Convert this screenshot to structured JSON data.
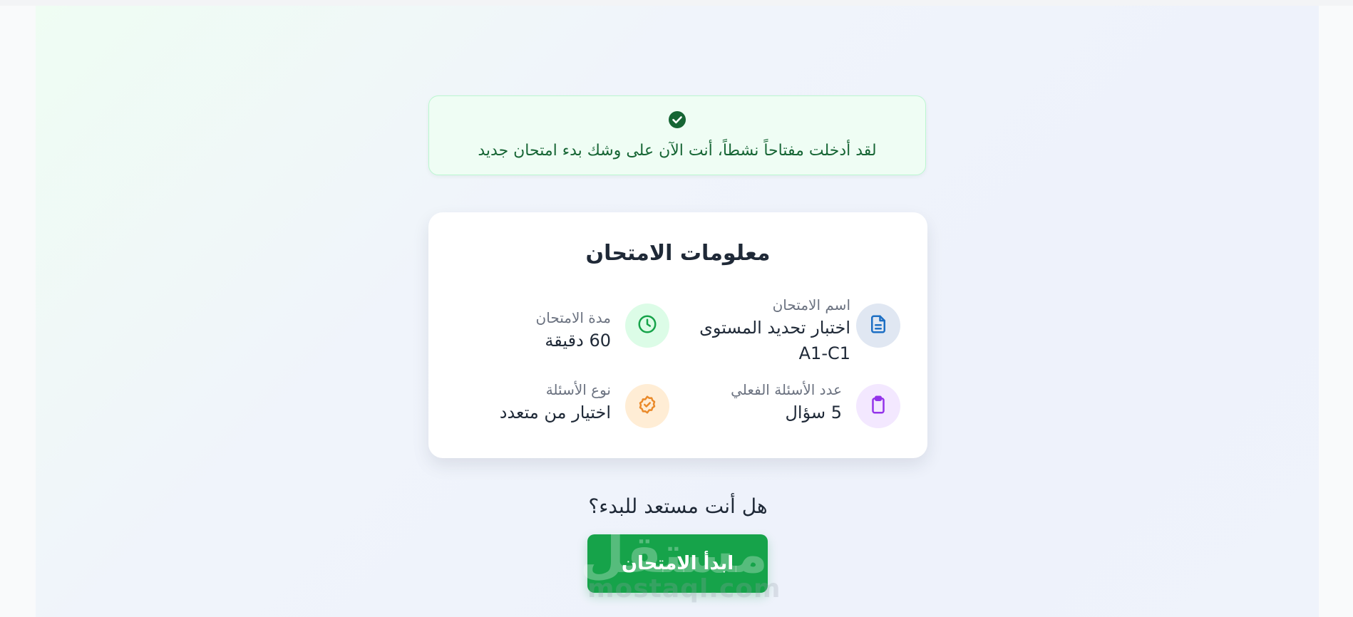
{
  "alert": {
    "icon": "check-circle-icon",
    "message": "لقد أدخلت مفتاحاً نشطاً، أنت الآن على وشك بدء امتحان جديد",
    "color": "#166534"
  },
  "card": {
    "title": "معلومات الامتحان",
    "items": [
      {
        "icon": "document-icon",
        "label": "اسم الامتحان",
        "value_line1": "اختبار تحديد المستوى",
        "value_line2": "A1-C1"
      },
      {
        "icon": "clock-icon",
        "label": "مدة الامتحان",
        "value": "60 دقيقة"
      },
      {
        "icon": "clipboard-icon",
        "label": "عدد الأسئلة الفعلي",
        "value": "5 سؤال"
      },
      {
        "icon": "check-badge-icon",
        "label": "نوع الأسئلة",
        "value": "اختيار من متعدد"
      }
    ]
  },
  "ready_prompt": "هل أنت مستعد للبدء؟",
  "start_button_label": "ابدأ الامتحان",
  "watermark": {
    "main": "مستقل",
    "sub": "mostaql.com"
  },
  "colors": {
    "accent": "#16a34a",
    "alert_bg": "#effdf4",
    "text": "#1f2937",
    "muted": "#6b7280"
  }
}
